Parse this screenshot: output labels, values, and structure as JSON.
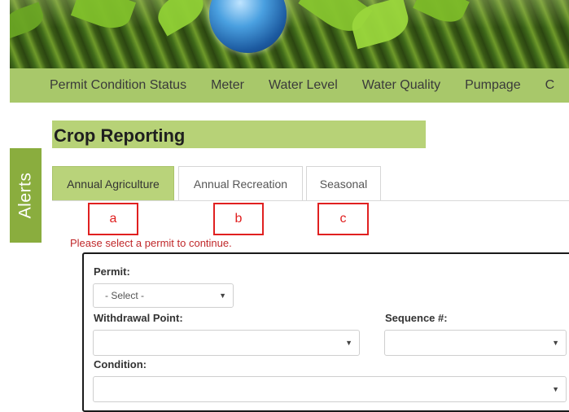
{
  "nav": {
    "items": [
      "Permit Condition Status",
      "Meter",
      "Water Level",
      "Water Quality",
      "Pumpage",
      "C"
    ]
  },
  "alerts_label": "Alerts",
  "page_title": "Crop Reporting",
  "tabs": [
    {
      "label": "Annual Agriculture",
      "active": true
    },
    {
      "label": "Annual Recreation",
      "active": false
    },
    {
      "label": "Seasonal",
      "active": false
    }
  ],
  "annotations": [
    "a",
    "b",
    "c"
  ],
  "message": "Please select a permit to continue.",
  "form": {
    "permit_label": "Permit:",
    "permit_value": "- Select -",
    "withdrawal_label": "Withdrawal Point:",
    "withdrawal_value": "",
    "sequence_label": "Sequence #:",
    "sequence_value": "",
    "condition_label": "Condition:",
    "condition_value": ""
  },
  "colors": {
    "nav_bg": "#a8c86a",
    "title_bg": "#b7d277",
    "active_tab_bg": "#b9d37a",
    "alerts_bg": "#8aad3e",
    "message_red": "#c0282a",
    "annotation_red": "#e02020"
  }
}
